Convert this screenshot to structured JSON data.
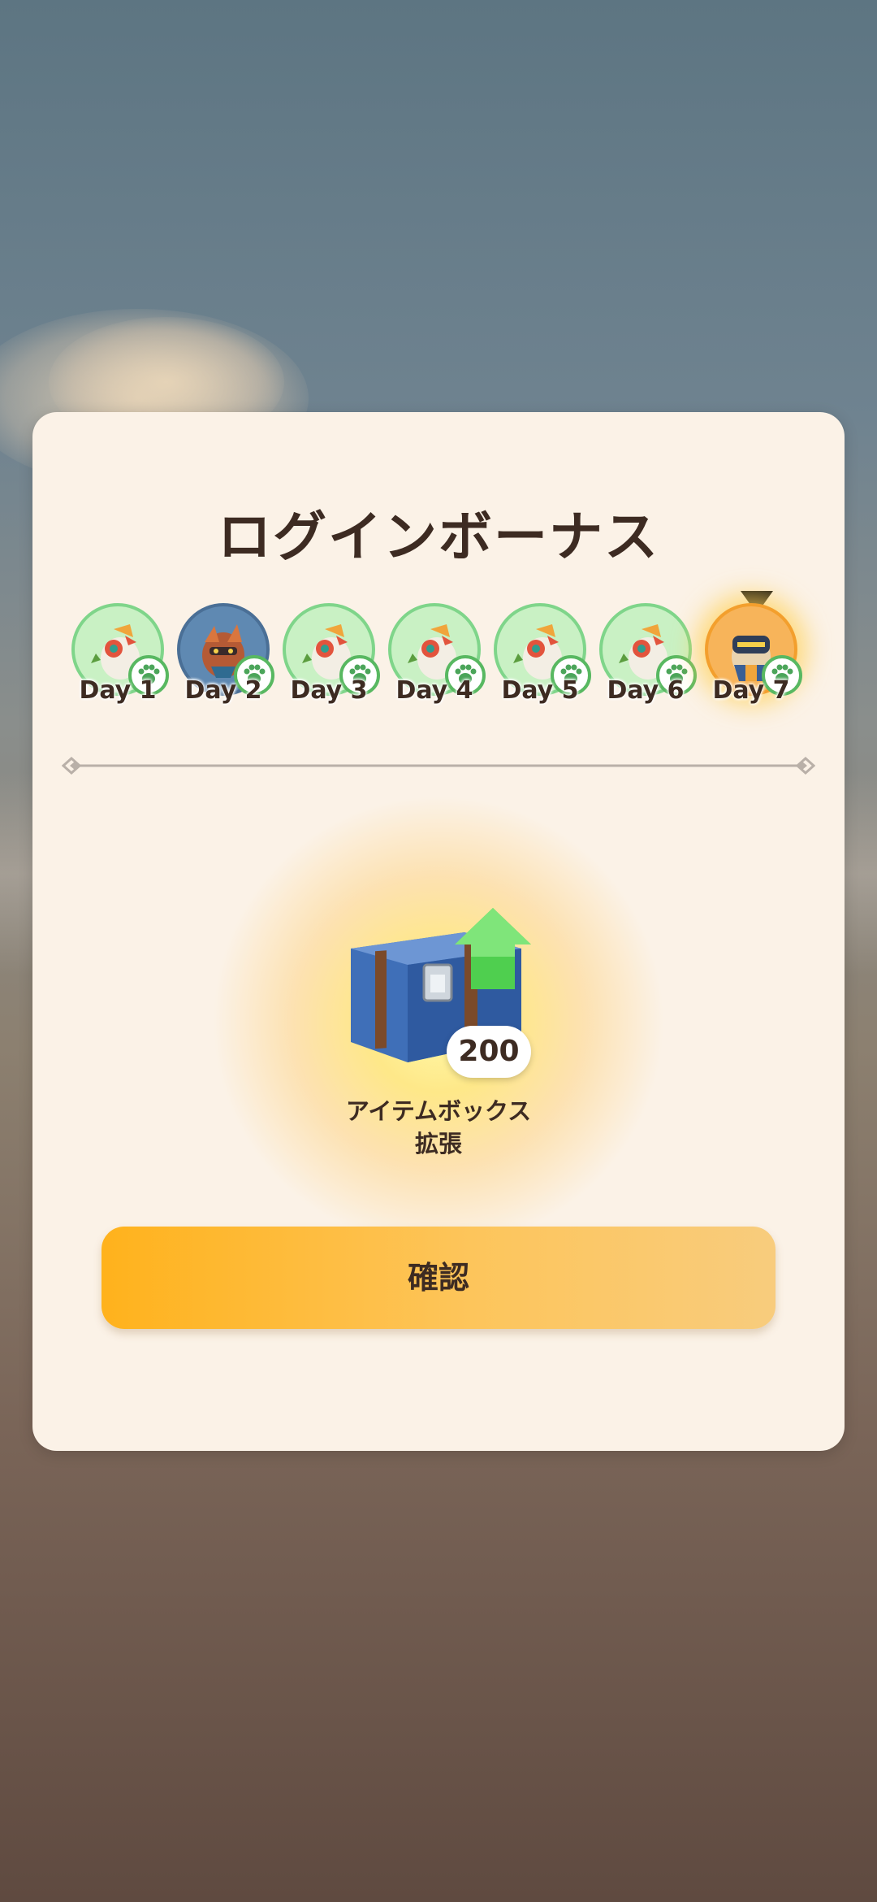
{
  "modal": {
    "title": "ログインボーナス",
    "days": [
      {
        "label": "Day 1",
        "style": "green",
        "icon": "bird-palico-icon"
      },
      {
        "label": "Day 2",
        "style": "blue",
        "icon": "monster-icon"
      },
      {
        "label": "Day 3",
        "style": "green",
        "icon": "bird-palico-icon"
      },
      {
        "label": "Day 4",
        "style": "green",
        "icon": "bird-palico-icon"
      },
      {
        "label": "Day 5",
        "style": "green",
        "icon": "bird-palico-icon"
      },
      {
        "label": "Day 6",
        "style": "green",
        "icon": "bird-palico-icon"
      },
      {
        "label": "Day 7",
        "style": "gold",
        "icon": "armored-palico-icon"
      }
    ],
    "current_day": "Day 7",
    "reward": {
      "count": "200",
      "name_line1": "アイテムボックス",
      "name_line2": "拡張",
      "icon": "item-box-chest-icon"
    },
    "confirm_label": "確認"
  },
  "colors": {
    "accent": "#ffb21c",
    "panel": "#fbf2e7",
    "text": "#3d2b22",
    "day_green": "#c9f1c4",
    "day_gold": "#f7b45a"
  }
}
